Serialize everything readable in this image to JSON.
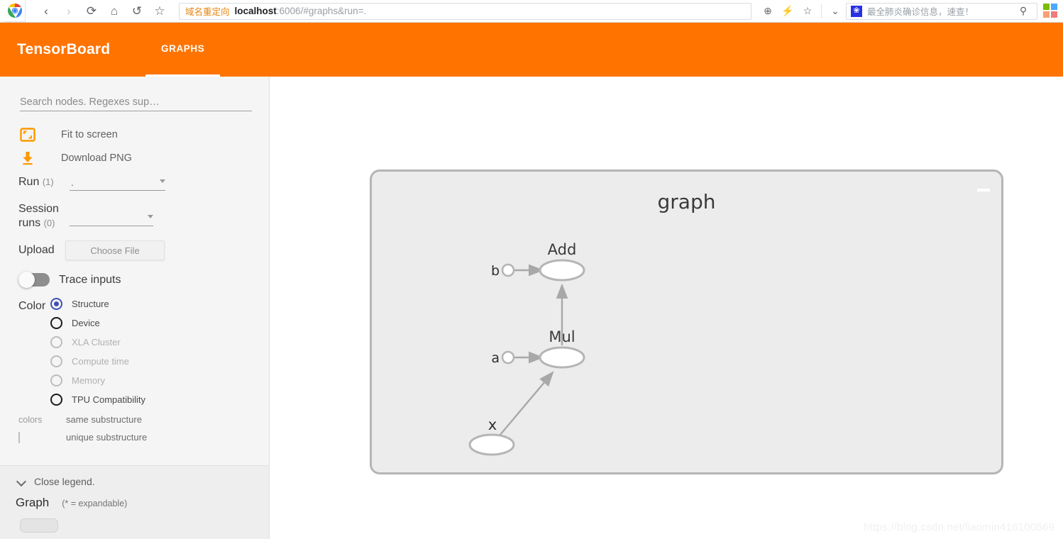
{
  "browser": {
    "nav": {
      "back": "‹",
      "forward": "›",
      "reload": "⟳",
      "home": "⌂",
      "history": "↺",
      "bookmark": "☆"
    },
    "address": {
      "badge": "域名重定向",
      "host": "localhost",
      "path": ":6006/#graphs&run=."
    },
    "address_icons": {
      "zoom": "⊕",
      "flash": "⚡",
      "star": "☆",
      "chevron": "⌄"
    },
    "search": {
      "engine_icon": "baidu-icon",
      "text": "最全肺炎确诊信息，速查！",
      "search_icon": "⚲"
    },
    "apps_colors": [
      "#7cbb00",
      "#4da6ff",
      "#f8a072",
      "#ef7c7c"
    ]
  },
  "header": {
    "brand": "TensorBoard",
    "tabs": [
      {
        "label": "GRAPHS",
        "active": true
      }
    ],
    "accent_color": "#ff7400"
  },
  "sidebar": {
    "search_nodes_placeholder": "Search nodes. Regexes sup…",
    "actions": [
      {
        "icon": "fit-to-screen-icon",
        "label": "Fit to screen"
      },
      {
        "icon": "download-png-icon",
        "label": "Download PNG"
      }
    ],
    "run": {
      "label": "Run",
      "count": "(1)",
      "value": "."
    },
    "session_runs": {
      "label": "Session runs",
      "count": "(0)",
      "value": ""
    },
    "upload": {
      "label": "Upload",
      "button": "Choose File"
    },
    "trace_inputs": {
      "label": "Trace inputs",
      "enabled": false
    },
    "color": {
      "label": "Color",
      "options": [
        {
          "label": "Structure",
          "selected": true,
          "disabled": false
        },
        {
          "label": "Device",
          "selected": false,
          "disabled": false
        },
        {
          "label": "XLA Cluster",
          "selected": false,
          "disabled": true
        },
        {
          "label": "Compute time",
          "selected": false,
          "disabled": true
        },
        {
          "label": "Memory",
          "selected": false,
          "disabled": true
        },
        {
          "label": "TPU Compatibility",
          "selected": false,
          "disabled": false
        }
      ]
    },
    "legend": {
      "colors_label": "colors",
      "same_substructure": "same substructure",
      "unique_substructure": "unique substructure"
    },
    "footer": {
      "close_legend": "Close legend.",
      "graph_label": "Graph",
      "expandable_hint": "(* = expandable)"
    }
  },
  "graph": {
    "title": "graph",
    "nodes": [
      {
        "id": "add",
        "label": "Add",
        "type": "op"
      },
      {
        "id": "mul",
        "label": "Mul",
        "type": "op"
      },
      {
        "id": "x",
        "label": "x",
        "type": "op"
      },
      {
        "id": "b",
        "label": "b",
        "type": "input"
      },
      {
        "id": "a",
        "label": "a",
        "type": "input"
      }
    ],
    "edges": [
      {
        "from": "b",
        "to": "add"
      },
      {
        "from": "mul",
        "to": "add"
      },
      {
        "from": "a",
        "to": "mul"
      },
      {
        "from": "x",
        "to": "mul"
      }
    ],
    "minimize_icon": "minimize-icon"
  },
  "watermark": "https://blog.csdn.net/liaomin416100569"
}
